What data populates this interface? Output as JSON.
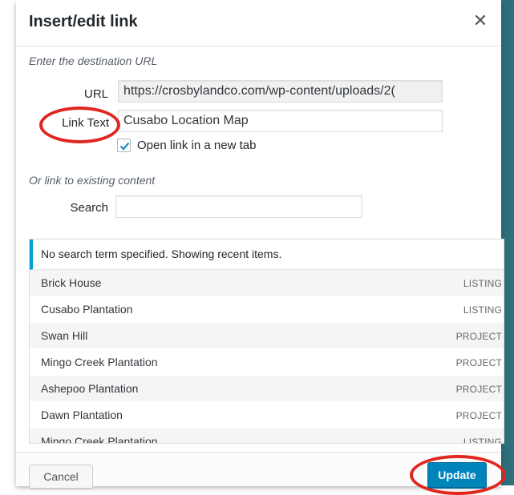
{
  "dialog": {
    "title": "Insert/edit link",
    "close_icon": "close-icon",
    "url_hint": "Enter the destination URL",
    "url_label": "URL",
    "url_value": "https://crosbylandco.com/wp-content/uploads/2(",
    "link_text_label": "Link Text",
    "link_text_value": "Cusabo Location Map",
    "new_tab_label": "Open link in a new tab",
    "new_tab_checked": true,
    "existing_hint": "Or link to existing content",
    "search_label": "Search",
    "search_value": ""
  },
  "results": {
    "notice": "No search term specified. Showing recent items.",
    "items": [
      {
        "title": "Brick House",
        "type": "LISTING"
      },
      {
        "title": "Cusabo Plantation",
        "type": "LISTING"
      },
      {
        "title": "Swan Hill",
        "type": "PROJECT"
      },
      {
        "title": "Mingo Creek Plantation",
        "type": "PROJECT"
      },
      {
        "title": "Ashepoo Plantation",
        "type": "PROJECT"
      },
      {
        "title": "Dawn Plantation",
        "type": "PROJECT"
      },
      {
        "title": "Mingo Creek Plantation",
        "type": "LISTING"
      }
    ]
  },
  "footer": {
    "cancel_label": "Cancel",
    "update_label": "Update"
  },
  "colors": {
    "background_teal": "#2f6f7c",
    "annotation_red": "#e0261e",
    "primary_blue": "#0085ba",
    "notice_border": "#00a0d2"
  }
}
